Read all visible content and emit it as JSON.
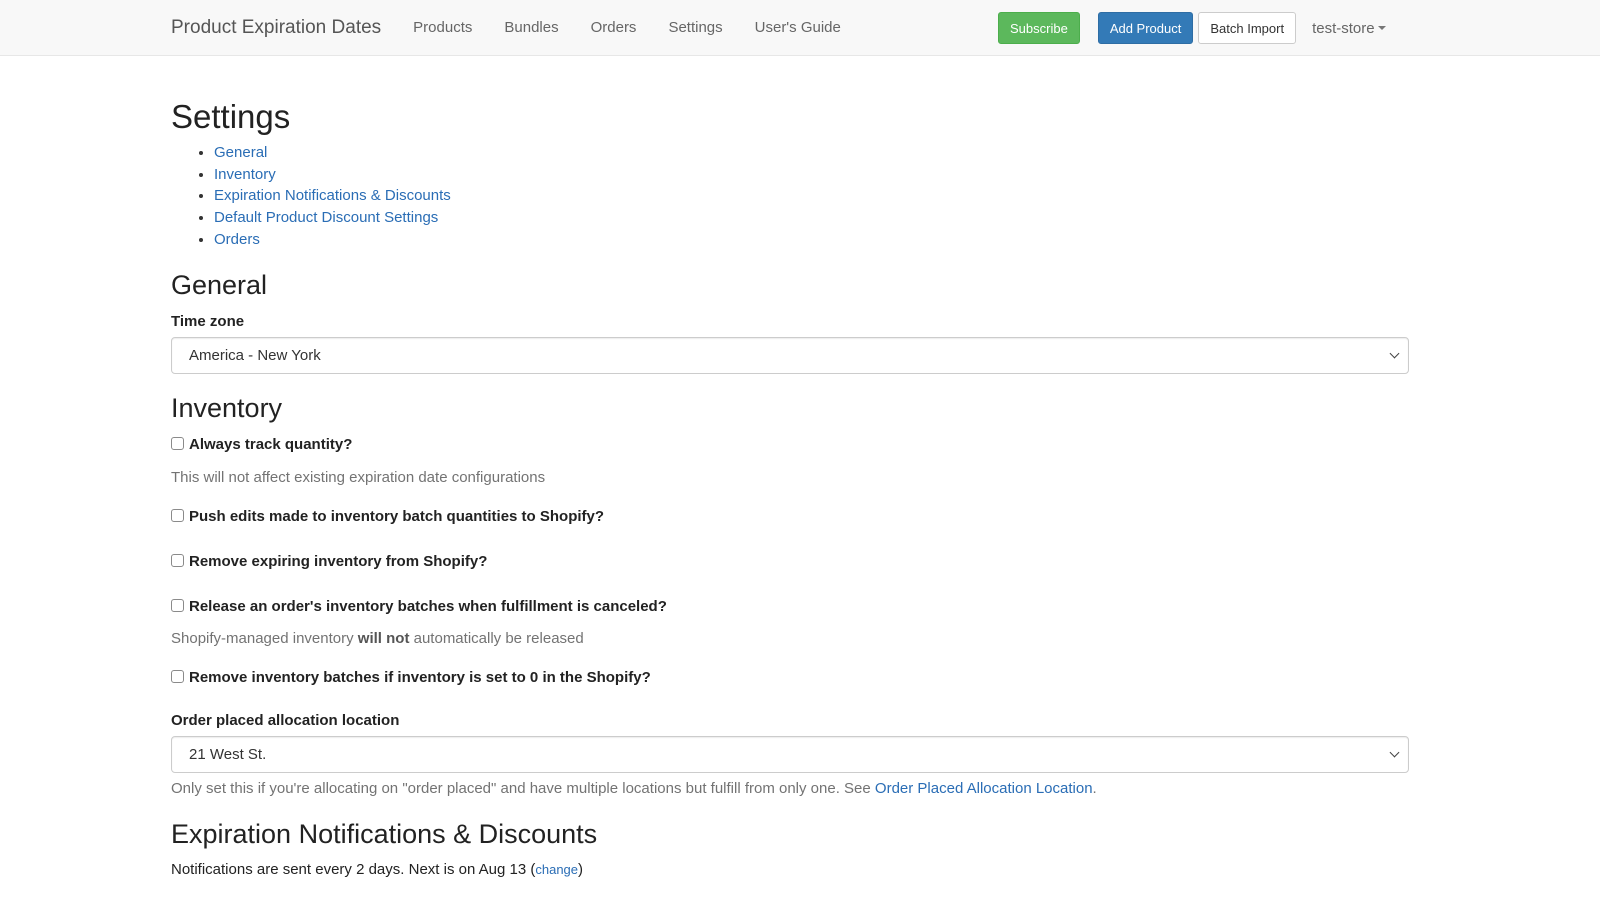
{
  "navbar": {
    "brand": "Product Expiration Dates",
    "links": [
      "Products",
      "Bundles",
      "Orders",
      "Settings",
      "User's Guide"
    ],
    "subscribe_label": "Subscribe",
    "add_product_label": "Add Product",
    "batch_import_label": "Batch Import",
    "store_name": "test-store",
    "colors": {
      "subscribe": "#5cb85c",
      "add_product": "#337ab7"
    }
  },
  "page": {
    "title": "Settings",
    "toc": [
      "General",
      "Inventory",
      "Expiration Notifications & Discounts",
      "Default Product Discount Settings",
      "Orders"
    ]
  },
  "general": {
    "heading": "General",
    "timezone_label": "Time zone",
    "timezone_value": "America - New York"
  },
  "inventory": {
    "heading": "Inventory",
    "options": [
      {
        "label": "Always track quantity?",
        "checked": false,
        "help": "This will not affect existing expiration date configurations"
      },
      {
        "label": "Push edits made to inventory batch quantities to Shopify?",
        "checked": false
      },
      {
        "label": "Remove expiring inventory from Shopify?",
        "checked": false
      },
      {
        "label": "Release an order's inventory batches when fulfillment is canceled?",
        "checked": false,
        "help_prefix": "Shopify-managed inventory ",
        "help_bold": "will not",
        "help_suffix": " automatically be released"
      },
      {
        "label": "Remove inventory batches if inventory is set to 0 in the Shopify?",
        "checked": false
      }
    ],
    "allocation_label": "Order placed allocation location",
    "allocation_value": "21 West St.",
    "allocation_help": "Only set this if you're allocating on \"order placed\" and have multiple locations but fulfill from only one. See ",
    "allocation_link": "Order Placed Allocation Location",
    "allocation_help_end": "."
  },
  "notifications": {
    "heading": "Expiration Notifications & Discounts",
    "text": "Notifications are sent every 2 days. Next is on Aug 13 (",
    "change_link": "change",
    "text_end": ")"
  }
}
